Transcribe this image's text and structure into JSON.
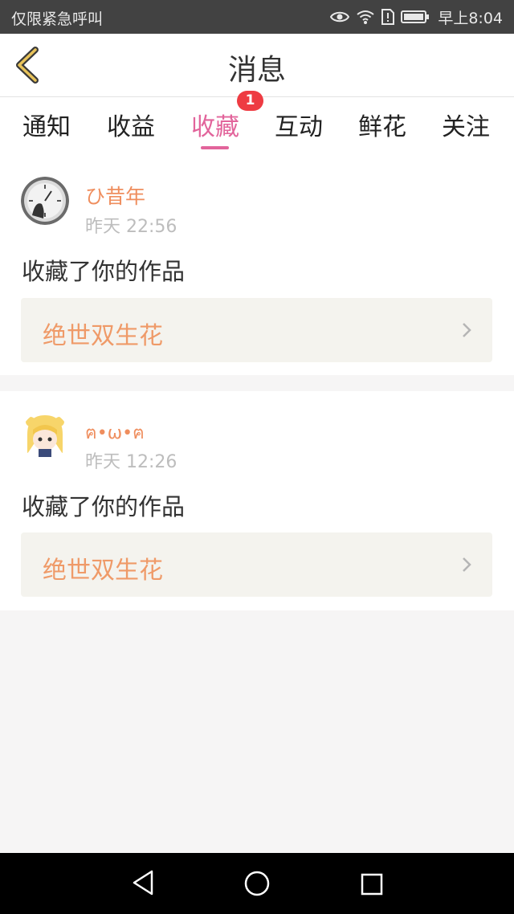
{
  "status_bar": {
    "carrier": "仅限紧急呼叫",
    "time": "早上8:04",
    "icons": [
      "eye-icon",
      "wifi-icon",
      "sim-alert-icon",
      "battery-icon"
    ]
  },
  "header": {
    "title": "消息",
    "back_icon": "chevron-left-icon"
  },
  "tabs": [
    {
      "label": "通知"
    },
    {
      "label": "收益"
    },
    {
      "label": "收藏"
    },
    {
      "label": "互动"
    },
    {
      "label": "鲜花"
    },
    {
      "label": "关注"
    }
  ],
  "active_tab": "收藏",
  "favorites_badge": "1",
  "notifications": [
    {
      "username": "ひ昔年",
      "time": "昨天 22:56",
      "message": "收藏了你的作品",
      "work_title": "绝世双生花"
    },
    {
      "username": "ฅ•ω•ฅ",
      "time": "昨天 12:26",
      "message": "收藏了你的作品",
      "work_title": "绝世双生花"
    }
  ],
  "system_nav": [
    "back-triangle-icon",
    "home-circle-icon",
    "recents-square-icon"
  ],
  "colors": {
    "accent": "#e2649b",
    "username": "#ef8e5e",
    "work_title": "#ef9a68",
    "badge": "#ee3b42",
    "page_bg": "#f6f5f5"
  }
}
